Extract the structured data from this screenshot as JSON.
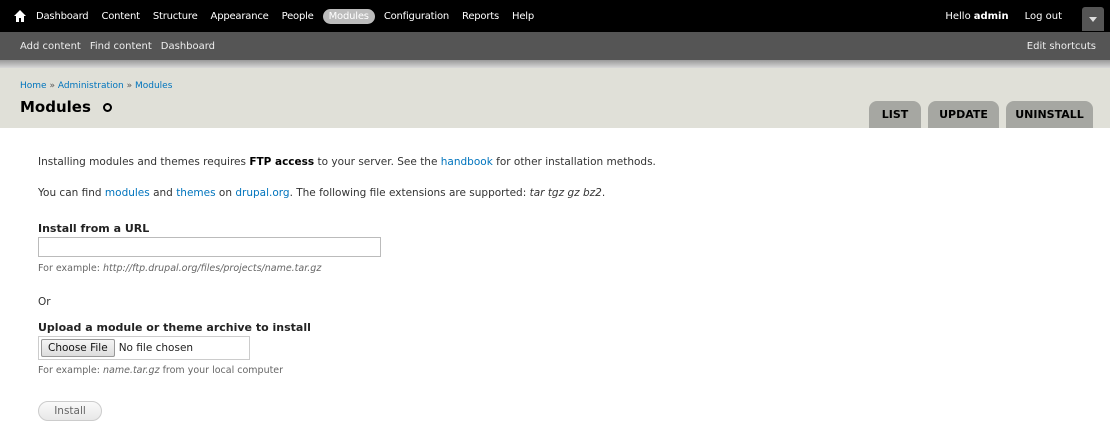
{
  "toolbar": {
    "menu": [
      "Dashboard",
      "Content",
      "Structure",
      "Appearance",
      "People",
      "Modules",
      "Configuration",
      "Reports",
      "Help"
    ],
    "active": "Modules",
    "hello": "Hello",
    "username": "admin",
    "logout": "Log out"
  },
  "shortcuts": {
    "links": [
      "Add content",
      "Find content",
      "Dashboard"
    ],
    "edit": "Edit shortcuts"
  },
  "breadcrumb": [
    "Home",
    "Administration",
    "Modules"
  ],
  "breadcrumb_sep": "»",
  "page_title": "Modules",
  "tabs": [
    "LIST",
    "UPDATE",
    "UNINSTALL"
  ],
  "intro": {
    "line1_a": "Installing modules and themes requires ",
    "line1_b": "FTP access",
    "line1_c": " to your server. See the ",
    "line1_link": "handbook",
    "line1_d": " for other installation methods.",
    "line2_a": "You can find ",
    "line2_modules": "modules",
    "line2_and": " and ",
    "line2_themes": "themes",
    "line2_on": " on ",
    "line2_drupal": "drupal.org",
    "line2_b": ". The following file extensions are supported: ",
    "line2_ext": "tar tgz gz bz2",
    "line2_end": "."
  },
  "url_field": {
    "label": "Install from a URL",
    "value": "",
    "desc_prefix": "For example: ",
    "desc_example": "http://ftp.drupal.org/files/projects/name.tar.gz"
  },
  "or_text": "Or",
  "upload_field": {
    "label": "Upload a module or theme archive to install",
    "button": "Choose File",
    "status": "No file chosen",
    "desc_prefix": "For example: ",
    "desc_example": "name.tar.gz",
    "desc_suffix": " from your local computer"
  },
  "install_button": "Install"
}
